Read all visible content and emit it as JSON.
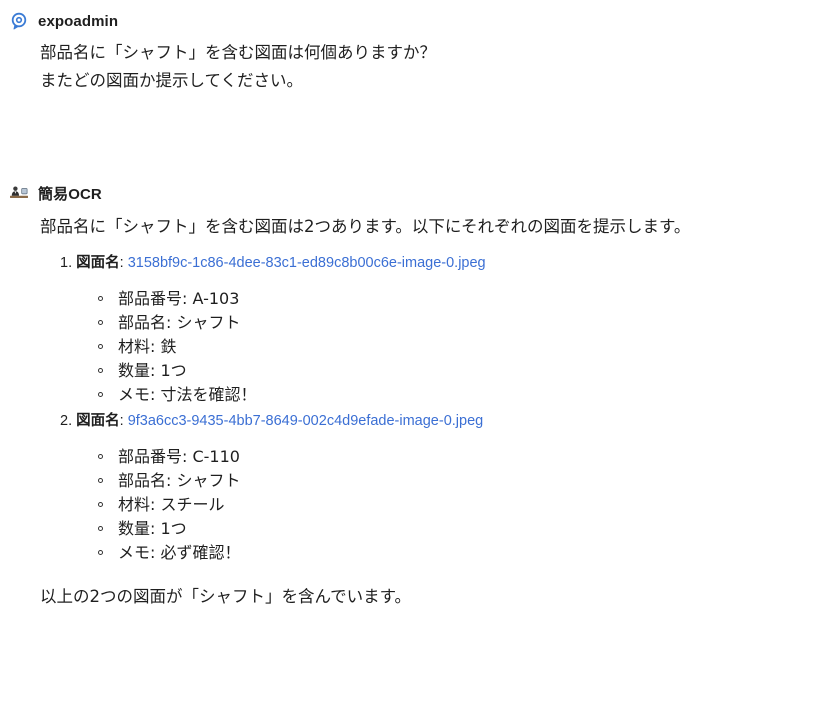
{
  "colors": {
    "link": "#3b6fd4",
    "text": "#1f1f1f",
    "user_avatar_accent": "#3a7bd5"
  },
  "user_message": {
    "sender": "expoadmin",
    "avatar_icon": "chat-bubble-icon",
    "lines": [
      "部品名に「シャフト」を含む図面は何個ありますか？",
      "またどの図面か提示してください。"
    ]
  },
  "bot_message": {
    "sender": "簡易OCR",
    "avatar_icon": "person-at-desk-icon",
    "intro": "部品名に「シャフト」を含む図面は2つあります。以下にそれぞれの図面を提示します。",
    "drawings": [
      {
        "number": "1.",
        "key_label": "図面名",
        "file_name": "3158bf9c-1c86-4dee-83c1-ed89c8b00c6e-image-0.jpeg",
        "details": [
          "部品番号: A-103",
          "部品名: シャフト",
          "材料: 鉄",
          "数量: 1つ",
          "メモ: 寸法を確認！"
        ]
      },
      {
        "number": "2.",
        "key_label": "図面名",
        "file_name": "9f3a6cc3-9435-4bb7-8649-002c4d9efade-image-0.jpeg",
        "details": [
          "部品番号: C-110",
          "部品名: シャフト",
          "材料: スチール",
          "数量: 1つ",
          "メモ: 必ず確認！"
        ]
      }
    ],
    "closing": "以上の2つの図面が「シャフト」を含んでいます。"
  }
}
